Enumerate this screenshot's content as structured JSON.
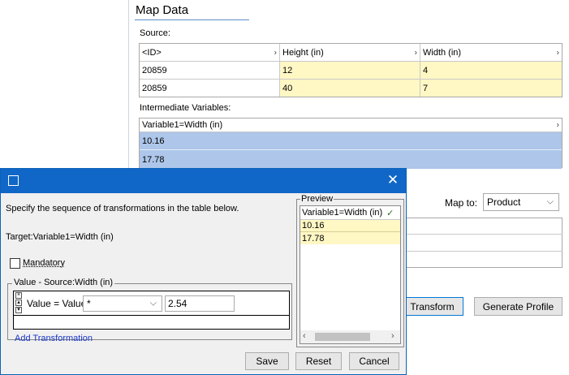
{
  "panel": {
    "title": "Map Data",
    "source_label": "Source:",
    "source_table": {
      "headers": [
        "<ID>",
        "Height (in)",
        "Width (in)"
      ],
      "rows": [
        [
          "20859",
          "12",
          "4"
        ],
        [
          "20859",
          "40",
          "7"
        ]
      ]
    },
    "intermediate_label": "Intermediate Variables:",
    "intermediate_table": {
      "header": "Variable1=Width (in)",
      "rows": [
        "10.16",
        "17.78"
      ]
    },
    "map_to_label": "Map to:",
    "map_to_value": "Product",
    "transform_label": "Transform",
    "generate_profile_label": "Generate Profile"
  },
  "dialog": {
    "instruction": "Specify the sequence of transformations in the table below.",
    "target": "Target:Variable1=Width (in)",
    "mandatory_label": "Mandatory",
    "value_group_legend": "Value - Source:Width (in)",
    "row_label": "Value = Value",
    "operator_value": "*",
    "operand_value": "2.54",
    "add_transformation": "Add Transformation",
    "preview_legend": "Preview",
    "preview_header": "Variable1=Width (in)",
    "preview_rows": [
      "10.16",
      "17.78"
    ],
    "save_label": "Save",
    "reset_label": "Reset",
    "cancel_label": "Cancel"
  }
}
